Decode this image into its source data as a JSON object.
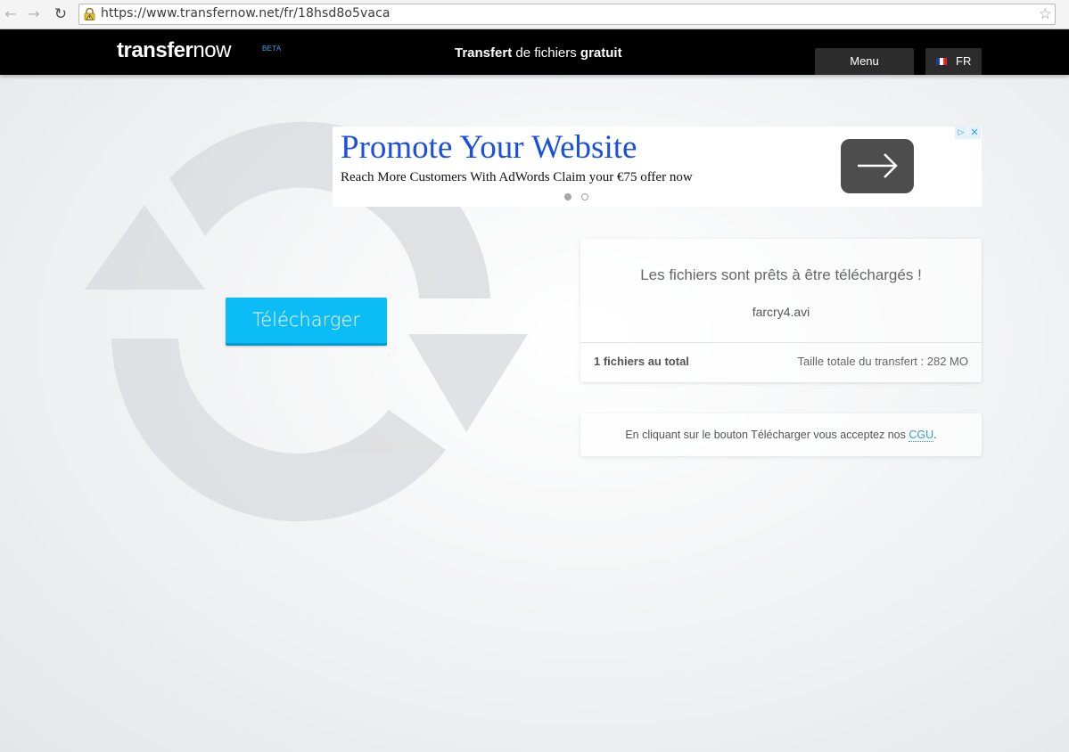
{
  "browser": {
    "url": "https://www.transfernow.net/fr/18hsd8o5vaca",
    "icons": [
      "back-icon",
      "forward-icon",
      "reload-icon",
      "lock-icon",
      "bookmark-star-icon"
    ]
  },
  "header": {
    "logo_transfer": "transfer",
    "logo_now": "now",
    "logo_badge": "BETA",
    "tagline_bold_1": "Transfert",
    "tagline_mid": " de fichiers ",
    "tagline_bold_2": "gratuit",
    "menu_label": "Menu",
    "lang_label": "FR"
  },
  "ad": {
    "headline": "Promote Your Website",
    "body": "Reach More Customers With AdWords Claim your €75 offer now",
    "choices_icon": "▷",
    "close_icon": "✕"
  },
  "main": {
    "download_label": "Télécharger",
    "files_ready_title": "Les fichiers sont prêts à être téléchargés !",
    "filename": "farcry4.avi",
    "file_count": "1 fichiers au total",
    "total_size": "Taille totale du transfert : 282 MO",
    "terms_prefix": "En cliquant sur le bouton Télécharger vous acceptez nos ",
    "terms_link": "CGU",
    "terms_suffix": "."
  },
  "colors": {
    "accent": "#0bbcf7",
    "header_bg": "#000000",
    "ad_headline": "#1a4fe0",
    "link": "#2a9fd6"
  }
}
